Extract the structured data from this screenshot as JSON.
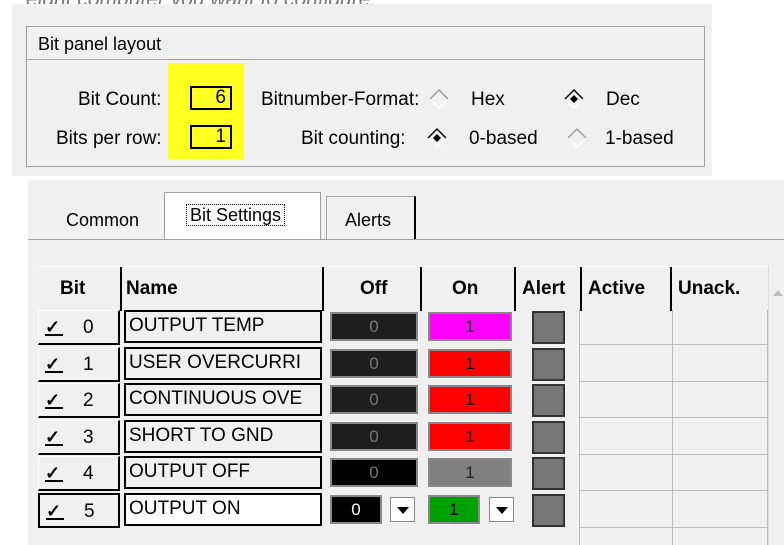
{
  "caption": "eight computer you want to configure.",
  "panel": {
    "title": "Bit panel layout",
    "bit_count_label": "Bit Count:",
    "bit_count_value": "6",
    "bits_per_row_label": "Bits per row:",
    "bits_per_row_value": "1",
    "format_label": "Bitnumber-Format:",
    "format_hex": "Hex",
    "format_dec": "Dec",
    "format_selected": "Dec",
    "counting_label": "Bit counting:",
    "counting_0": "0-based",
    "counting_1": "1-based",
    "counting_selected": "0-based",
    "highlight_color": "#ffff20"
  },
  "tabs": [
    {
      "label": "Common"
    },
    {
      "label": "Bit Settings",
      "active": true
    },
    {
      "label": "Alerts"
    }
  ],
  "grid": {
    "columns": [
      "Bit",
      "Name",
      "Off",
      "On",
      "Alert",
      "Active",
      "Unack."
    ],
    "rows": [
      {
        "bit": "0",
        "checked": true,
        "name": "OUTPUT TEMP",
        "off": "0",
        "off_color": "#1e1e1e",
        "on": "1",
        "on_color": "#ff00ff"
      },
      {
        "bit": "1",
        "checked": true,
        "name": "USER OVERCURRI",
        "off": "0",
        "off_color": "#1e1e1e",
        "on": "1",
        "on_color": "#ff0000"
      },
      {
        "bit": "2",
        "checked": true,
        "name": "CONTINUOUS OVE",
        "off": "0",
        "off_color": "#1e1e1e",
        "on": "1",
        "on_color": "#ff0000"
      },
      {
        "bit": "3",
        "checked": true,
        "name": "SHORT TO GND",
        "off": "0",
        "off_color": "#1e1e1e",
        "on": "1",
        "on_color": "#ff0000"
      },
      {
        "bit": "4",
        "checked": true,
        "name": "OUTPUT OFF",
        "off": "0",
        "off_color": "#000000",
        "on": "1",
        "on_color": "#808080"
      },
      {
        "bit": "5",
        "checked": true,
        "name": "OUTPUT ON",
        "off": "0",
        "off_color": "#000000",
        "on": "1",
        "on_color": "#00a000",
        "editing": true
      }
    ]
  },
  "icons": {
    "check": "checkmark-icon",
    "dropdown": "chevron-down-icon",
    "radio": "diamond-radio-icon"
  }
}
